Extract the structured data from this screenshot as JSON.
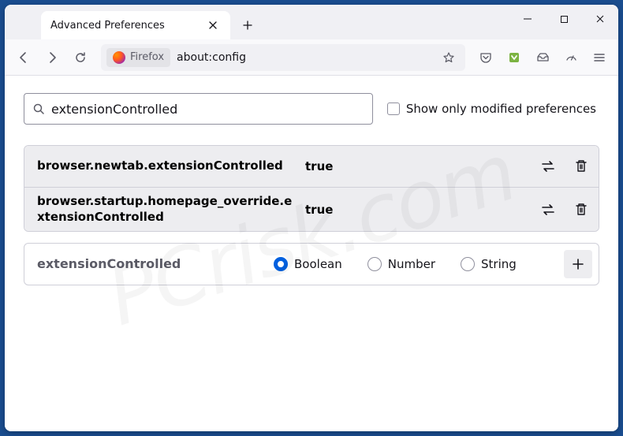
{
  "window": {
    "tab_title": "Advanced Preferences"
  },
  "toolbar": {
    "identity_label": "Firefox",
    "url": "about:config"
  },
  "search": {
    "value": "extensionControlled",
    "modified_only_label": "Show only modified preferences"
  },
  "prefs": [
    {
      "name": "browser.newtab.extensionControlled",
      "value": "true"
    },
    {
      "name": "browser.startup.homepage_override.extensionControlled",
      "value": "true"
    }
  ],
  "new_pref": {
    "name": "extensionControlled",
    "types": [
      "Boolean",
      "Number",
      "String"
    ],
    "selected": "Boolean"
  },
  "watermark": "PCrisk.com"
}
